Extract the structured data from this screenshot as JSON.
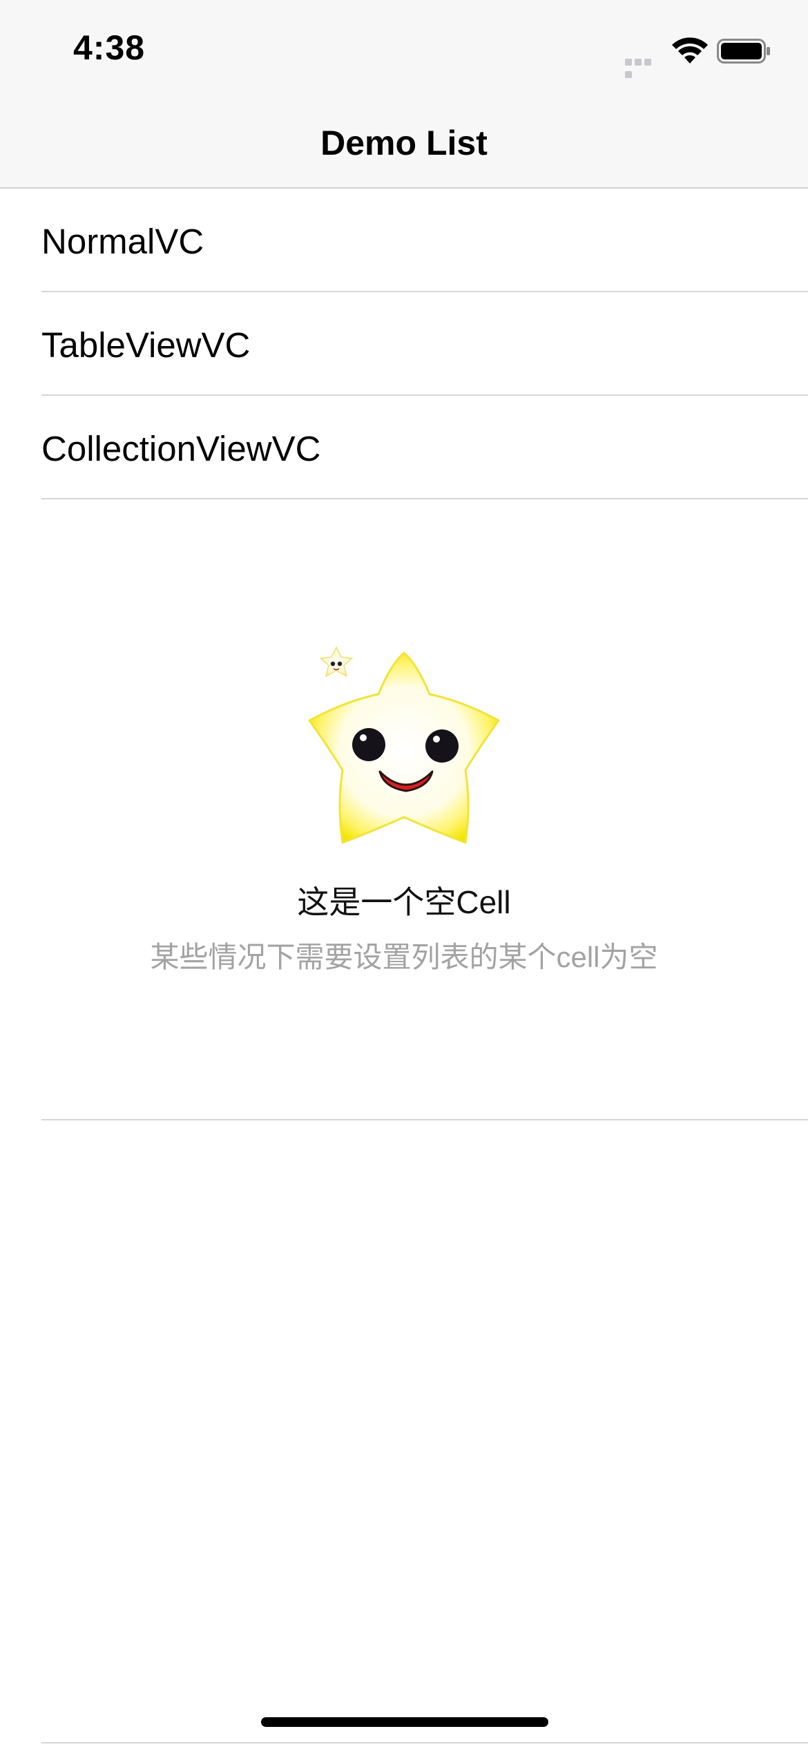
{
  "status_bar": {
    "time": "4:38"
  },
  "nav": {
    "title": "Demo List"
  },
  "list": {
    "items": [
      {
        "label": "NormalVC"
      },
      {
        "label": "TableViewVC"
      },
      {
        "label": "CollectionViewVC"
      }
    ]
  },
  "empty_cell": {
    "title": "这是一个空Cell",
    "subtitle": "某些情况下需要设置列表的某个cell为空",
    "illustration": "smiling-star-icon"
  },
  "colors": {
    "nav_background": "#f7f7f7",
    "separator": "#d6d6d8",
    "subtitle_text": "#a3a3a3",
    "star_fill": "#fff36b"
  }
}
